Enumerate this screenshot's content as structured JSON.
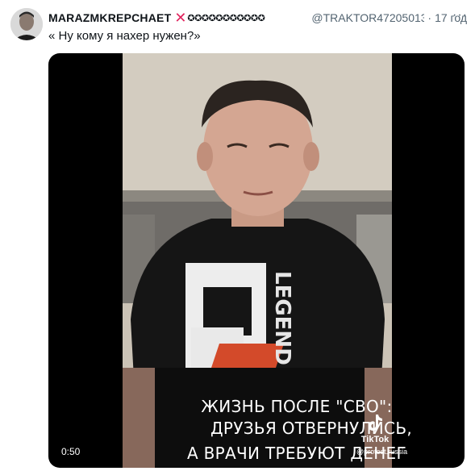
{
  "tweet": {
    "display_name": "MARAZMKREPCHAET",
    "x_mark": "✕",
    "decorative_symbols": "✪✪✪✪✪✪✪✪✪✪✪",
    "handle": "@TRAKTOR47205013",
    "dot": "·",
    "time": "17 год",
    "more": "···",
    "text": "« Ну кому я нахер нужен?»"
  },
  "media": {
    "caption_line1": "ЖИЗНЬ ПОСЛЕ \"СВО\":",
    "caption_line2": "ДРУЗЬЯ ОТВЕРНУЛИСЬ,",
    "caption_line3": "А ВРАЧИ ТРЕБУЮТ ДЕНЕГ",
    "duration": "0:50",
    "watermark_brand": "TikTok",
    "watermark_user": "@protest.russia",
    "shirt_print": "LEGEND"
  },
  "colors": {
    "accent_red": "#e0245e",
    "secondary_text": "#536471",
    "video_bg": "#000000"
  }
}
